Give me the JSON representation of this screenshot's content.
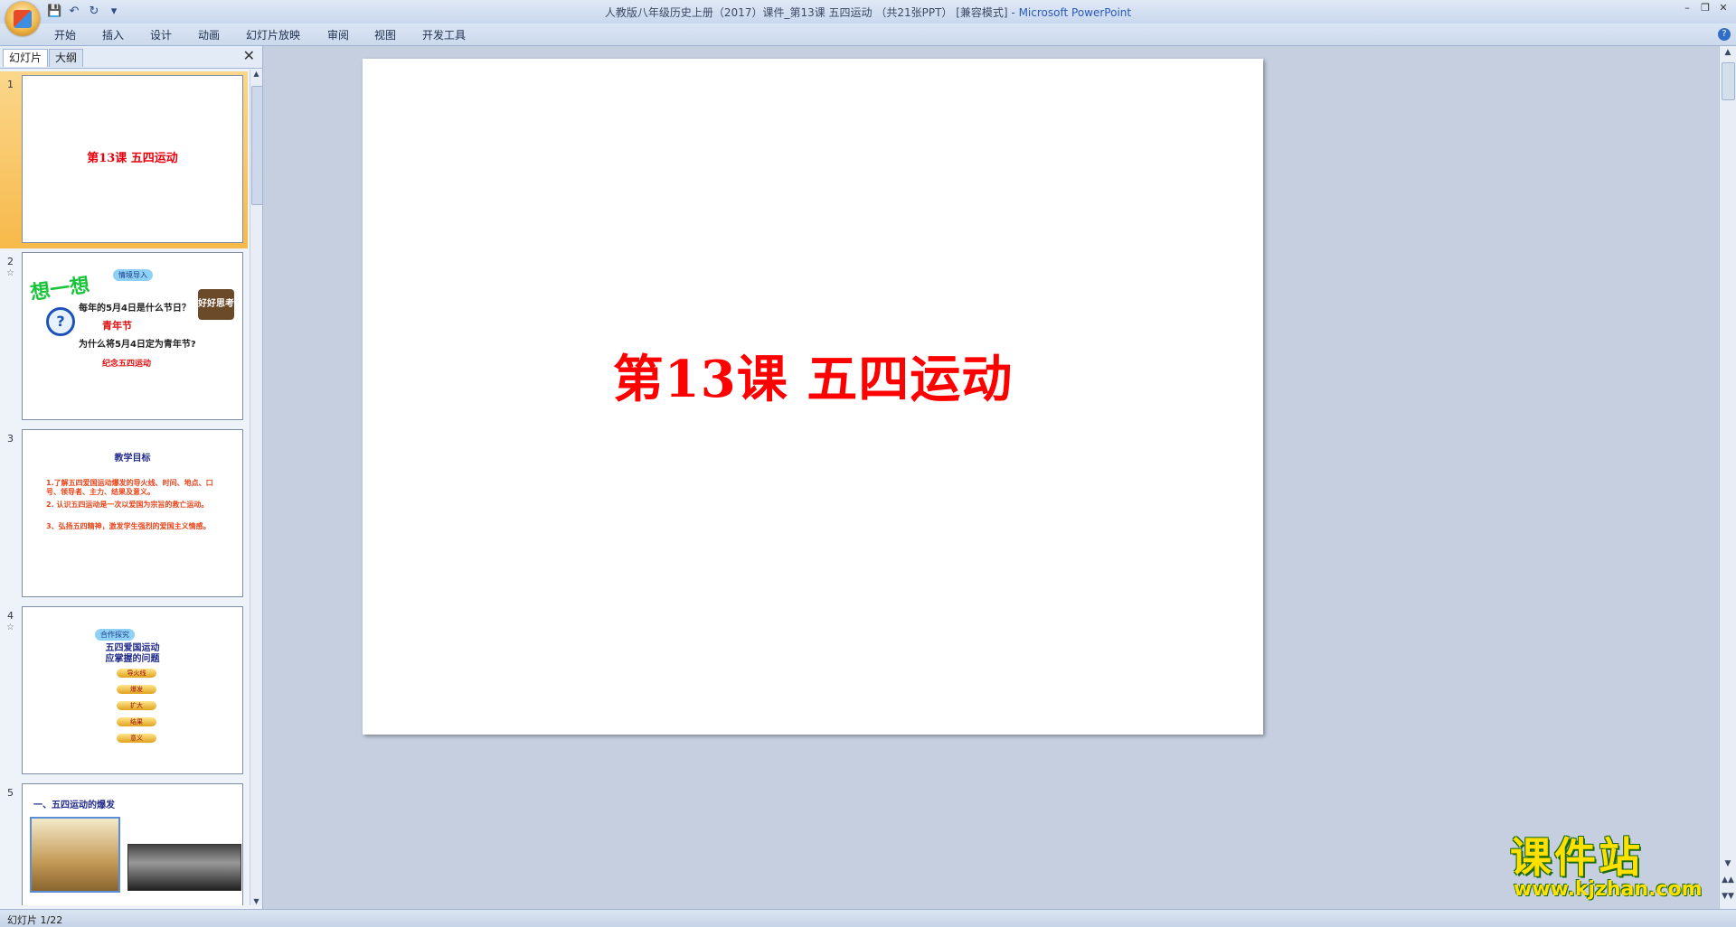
{
  "window": {
    "title": "人教版八年级历史上册（2017）课件_第13课 五四运动 （共21张PPT） [兼容模式]",
    "app_name": "- Microsoft PowerPoint"
  },
  "quick_access": [
    "save-icon",
    "undo-icon",
    "redo-icon",
    "customize-icon"
  ],
  "ribbon_tabs": [
    "开始",
    "插入",
    "设计",
    "动画",
    "幻灯片放映",
    "审阅",
    "视图",
    "开发工具"
  ],
  "pane": {
    "tabs": [
      "幻灯片",
      "大纲"
    ],
    "active_tab": "幻灯片"
  },
  "thumbnails": [
    {
      "num": "1",
      "title": "第13课  五四运动"
    },
    {
      "num": "2",
      "badge": "情境导入",
      "think": "想一想",
      "q1": "每年的5月4日是什么节日？",
      "a1": "青年节",
      "q2": "为什么将5月4日定为青年节?",
      "a2": "纪念五四运动",
      "stamp": "好好思考"
    },
    {
      "num": "3",
      "title": "教学目标",
      "items": [
        "1.了解五四爱国运动爆发的导火线、时间、地点、口号、领导者、主力、结果及意义。",
        "2. 认识五四运动是一次以爱国为宗旨的救亡运动。",
        "3、弘扬五四精神，激发学生强烈的爱国主义情感。"
      ]
    },
    {
      "num": "4",
      "badge": "合作探究",
      "heading_line1": "五四爱国运动",
      "heading_line2": "应掌握的问题",
      "pills": [
        "导火线",
        "爆发",
        "扩大",
        "结果",
        "意义"
      ]
    },
    {
      "num": "5",
      "title": "一、五四运动的爆发"
    }
  ],
  "slide": {
    "title": "第13课  五四运动",
    "title_color": "#ff0000"
  },
  "status": {
    "slide_indicator": "幻灯片 1/22"
  },
  "watermark": {
    "cn": "课件站",
    "url": "www.kjzhan.com"
  }
}
